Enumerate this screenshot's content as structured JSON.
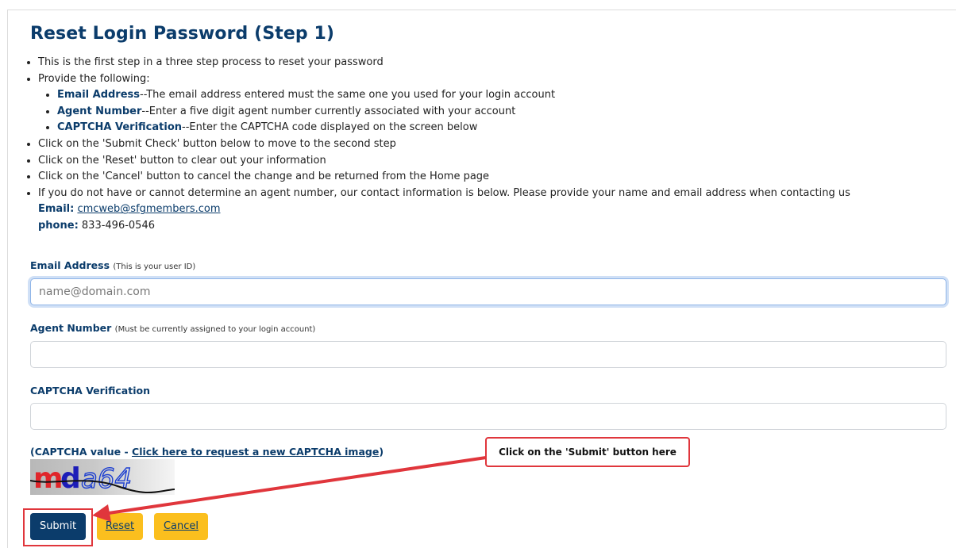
{
  "page": {
    "title": "Reset Login Password (Step 1)"
  },
  "instructions": {
    "step_intro": "This is the first step in a three step process to reset your password",
    "provide": "Provide the following:",
    "fields": [
      {
        "name": "Email Address",
        "desc": "--The email address entered must the same one you used for your login account"
      },
      {
        "name": "Agent Number",
        "desc": "--Enter a five digit agent number currently associated with your account"
      },
      {
        "name": "CAPTCHA Verification",
        "desc": "--Enter the CAPTCHA code displayed on the screen below"
      }
    ],
    "submit_note": "Click on the 'Submit Check' button below to move to the second step",
    "reset_note": "Click on the 'Reset' button to clear out your information",
    "cancel_note": "Click on the 'Cancel' button to cancel the change and be returned from the Home page",
    "contact_note": "If you do not have or cannot determine an agent number, our contact information is below.  Please provide your name and email address when contacting us",
    "email_label": "Email:",
    "email_value": "cmcweb@sfgmembers.com",
    "phone_label": "phone:",
    "phone_value": "833-496-0546"
  },
  "form": {
    "email": {
      "label": "Email Address",
      "hint": "(This is your user ID)",
      "placeholder": "name@domain.com",
      "value": ""
    },
    "agent": {
      "label": "Agent Number",
      "hint": "(Must be currently assigned to your login account)",
      "value": ""
    },
    "captcha": {
      "label": "CAPTCHA Verification",
      "value": ""
    },
    "captcha_value_prefix": "(CAPTCHA value - ",
    "captcha_link": "Click here to request a new CAPTCHA image",
    "captcha_value_suffix": ")",
    "captcha_image_text": "mda64"
  },
  "buttons": {
    "submit": "Submit",
    "reset": "Reset",
    "cancel": "Cancel"
  },
  "annotation": {
    "callout": "Click on the 'Submit' button here",
    "color": "#e0363c"
  },
  "colors": {
    "heading": "#0b3c6b",
    "primary_button": "#0b3c6b",
    "secondary_button": "#fbbf1e"
  }
}
